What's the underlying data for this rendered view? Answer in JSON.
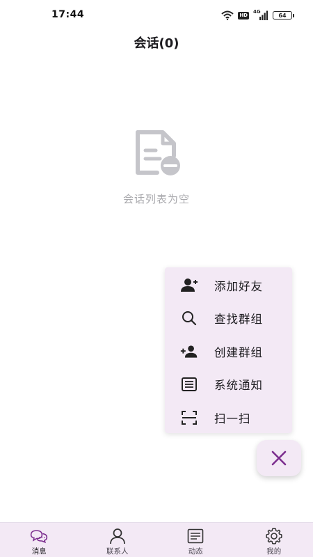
{
  "status_bar": {
    "time": "17:44",
    "network": "4G",
    "hd": "HD",
    "battery": "64",
    "icons": [
      "wifi-icon",
      "hd-icon",
      "signal-icon",
      "battery-icon"
    ]
  },
  "header": {
    "title": "会话(0)"
  },
  "empty_state": {
    "icon": "document-remove-icon",
    "text": "会话列表为空"
  },
  "popup_menu": {
    "items": [
      {
        "label": "添加好友",
        "icon": "add-person-icon"
      },
      {
        "label": "查找群组",
        "icon": "search-icon"
      },
      {
        "label": "创建群组",
        "icon": "add-person-icon"
      },
      {
        "label": "系统通知",
        "icon": "notice-icon"
      },
      {
        "label": "扫一扫",
        "icon": "scan-icon"
      }
    ]
  },
  "fab": {
    "icon": "close-icon"
  },
  "bottom_nav": {
    "items": [
      {
        "label": "消息",
        "icon": "chat-bubbles-icon",
        "active": true
      },
      {
        "label": "联系人",
        "icon": "person-icon",
        "active": false
      },
      {
        "label": "动态",
        "icon": "feed-icon",
        "active": false
      },
      {
        "label": "我的",
        "icon": "gear-icon",
        "active": false
      }
    ]
  },
  "colors": {
    "accent": "#7b2d8e",
    "menu_bg": "#f3e9f5",
    "empty_text": "#a9a9ad",
    "empty_icon": "#c5c5ca"
  }
}
